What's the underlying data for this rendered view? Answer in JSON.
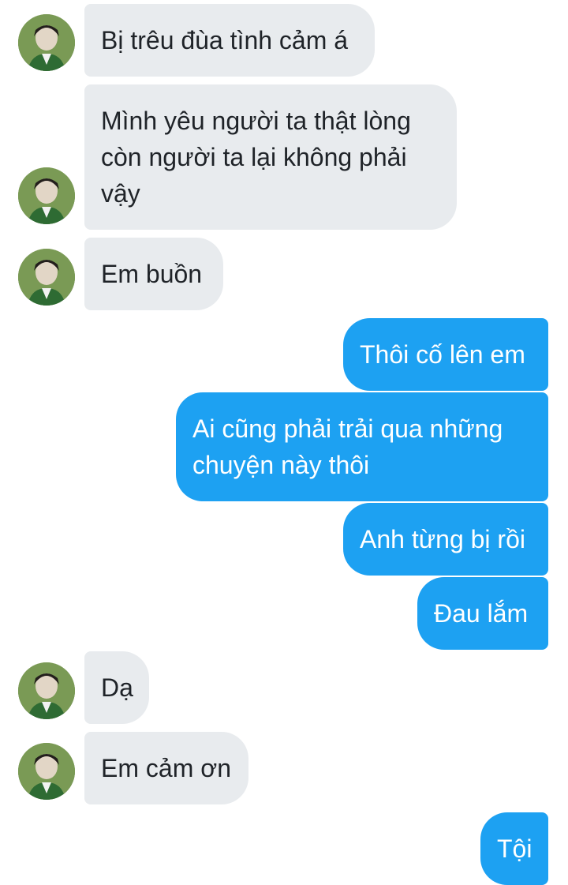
{
  "messages": [
    {
      "from": "them",
      "text": "Bị trêu đùa tình cảm á"
    },
    {
      "from": "them",
      "text": "Mình yêu người ta thật lòng còn người ta lại không phải vậy"
    },
    {
      "from": "them",
      "text": "Em buồn"
    },
    {
      "from": "me",
      "text": "Thôi cố lên em"
    },
    {
      "from": "me",
      "text": "Ai cũng phải trải qua những chuyện này thôi"
    },
    {
      "from": "me",
      "text": "Anh từng bị rồi"
    },
    {
      "from": "me",
      "text": "Đau lắm"
    },
    {
      "from": "them",
      "text": "Dạ"
    },
    {
      "from": "them",
      "text": "Em cảm ơn"
    },
    {
      "from": "me",
      "text": "Tội"
    }
  ],
  "colors": {
    "incoming_bubble": "#e8ebee",
    "outgoing_bubble": "#1da1f2",
    "incoming_text": "#1f2328",
    "outgoing_text": "#ffffff"
  },
  "icons": {
    "avatar": "user-avatar-photo"
  }
}
